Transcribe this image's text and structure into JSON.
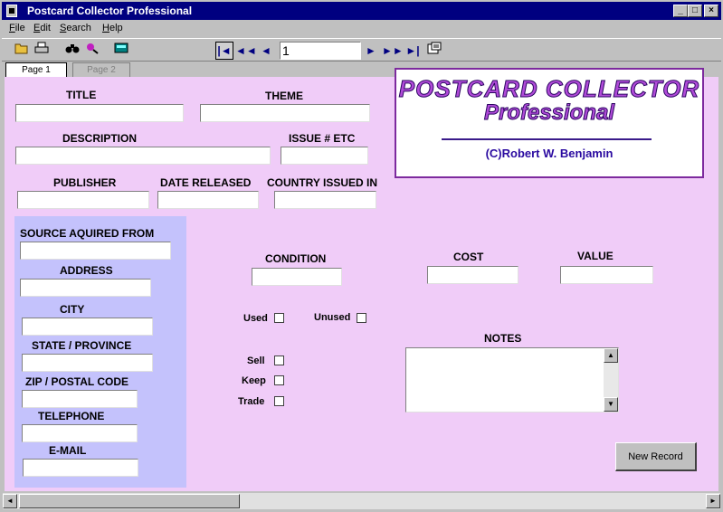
{
  "window": {
    "title": "Postcard Collector Professional"
  },
  "menu": {
    "items": [
      "File",
      "Edit",
      "Search",
      "Help"
    ]
  },
  "toolbar": {
    "record_number": "1",
    "icons": [
      "open-folder-icon",
      "print-icon",
      "binoculars-icon",
      "find-replace-icon",
      "calculator-icon",
      "first-record-icon",
      "rewind-icon",
      "previous-icon",
      "next-icon",
      "fast-forward-icon",
      "last-record-icon",
      "record-properties-icon"
    ]
  },
  "tabs": {
    "page1": "Page 1",
    "page2": "Page 2"
  },
  "logo": {
    "line1": "POSTCARD COLLECTOR",
    "line2": "Professional",
    "credit": "(C)Robert W. Benjamin"
  },
  "fields": {
    "title": "TITLE",
    "theme": "THEME",
    "description": "DESCRIPTION",
    "issue": "ISSUE # ETC",
    "publisher": "PUBLISHER",
    "date_released": "DATE RELEASED",
    "country": "COUNTRY ISSUED IN",
    "source": "SOURCE AQUIRED FROM",
    "address": "ADDRESS",
    "city": "CITY",
    "state": "STATE / PROVINCE",
    "zip": "ZIP / POSTAL CODE",
    "telephone": "TELEPHONE",
    "email": "E-MAIL",
    "condition": "CONDITION",
    "cost": "COST",
    "value": "VALUE",
    "notes": "NOTES"
  },
  "checkboxes": {
    "used": "Used",
    "unused": "Unused",
    "sell": "Sell",
    "keep": "Keep",
    "trade": "Trade"
  },
  "buttons": {
    "new_record": "New Record"
  },
  "colors": {
    "title_bar": "#000080",
    "form_bg": "#f0ccf8",
    "address_panel": "#c4c2fc",
    "logo_text": "#b04ad8"
  }
}
